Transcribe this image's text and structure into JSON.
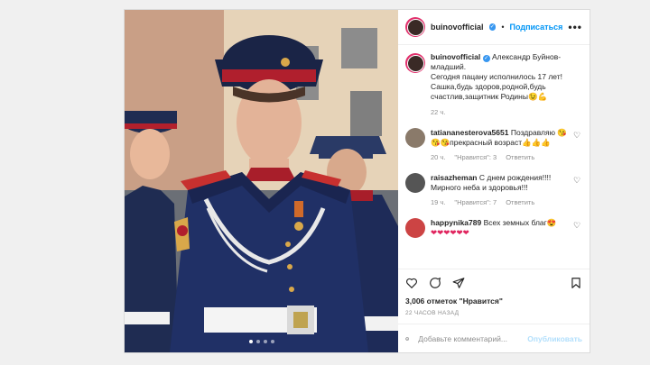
{
  "post": {
    "username": "buinovofficial",
    "follow_label": "Подписаться",
    "more_icon": "•••",
    "caption": {
      "username": "buinovofficial",
      "text_line1": "Александр Буйнов-младший.",
      "text_line2": "Сегодня пацану исполнилось 17 лет! Сашка,будь здоров,родной,будь счастлив,защитник Родины😉💪",
      "time": "22 ч."
    },
    "comments": [
      {
        "username": "tatiananesterova5651",
        "text": "Поздравляю 😘😘😘прекрасный возраст👍👍👍",
        "time": "20 ч.",
        "likes": "\"Нравится\": 3",
        "reply": "Ответить"
      },
      {
        "username": "raisazheman",
        "text": "С днем рождения!!!! Мирного неба и здоровья!!!",
        "time": "19 ч.",
        "likes": "\"Нравится\": 7",
        "reply": "Ответить"
      },
      {
        "username": "happynika789",
        "text": "Всех земных благ😍",
        "extra": "❤❤❤❤❤❤"
      }
    ],
    "likes_text": "3,006 отметок \"Нравится\"",
    "time_ago": "22 часов назад",
    "add_comment_placeholder": "Добавьте комментарий...",
    "publish_label": "Опубликовать",
    "carousel": {
      "count": 4,
      "active_index": 0
    }
  },
  "colors": {
    "accent": "#0095f6",
    "verified": "#3897f0",
    "muted": "#8e8e8e"
  }
}
